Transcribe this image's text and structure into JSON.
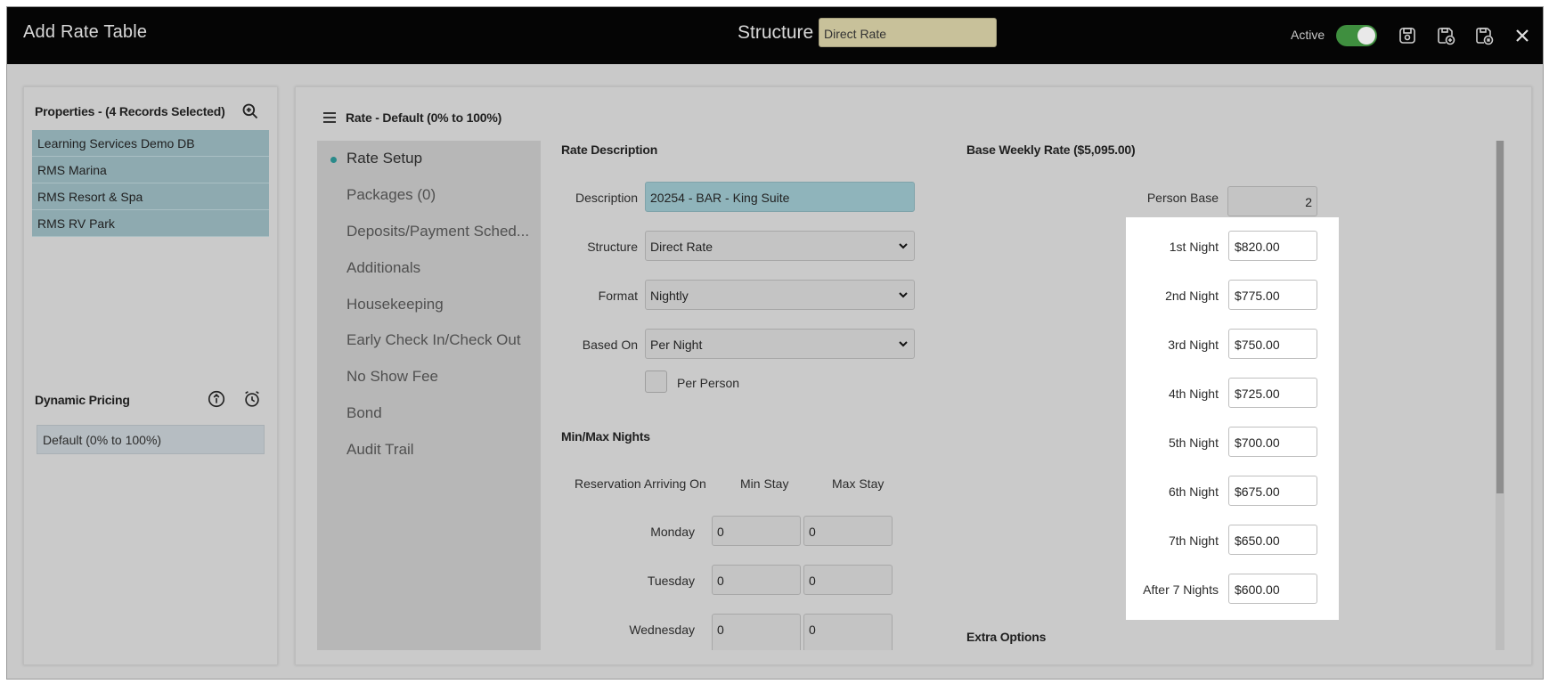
{
  "header": {
    "title": "Add Rate Table",
    "structure_label": "Structure",
    "structure_value": "Direct Rate",
    "active_label": "Active",
    "active": true,
    "icons": [
      "save-icon",
      "save-add-icon",
      "save-copy-icon",
      "close-icon"
    ]
  },
  "properties": {
    "heading": "Properties - (4 Records Selected)",
    "items": [
      "Learning Services Demo DB",
      "RMS Marina",
      "RMS Resort & Spa",
      "RMS RV Park"
    ]
  },
  "dynamic_pricing": {
    "heading": "Dynamic Pricing",
    "item": "Default (0% to 100%)"
  },
  "main": {
    "heading": "Rate - Default (0% to 100%)",
    "nav": [
      "Rate Setup",
      "Packages (0)",
      "Deposits/Payment Sched...",
      "Additionals",
      "Housekeeping",
      "Early Check In/Check Out",
      "No Show Fee",
      "Bond",
      "Audit Trail"
    ],
    "rate_description": {
      "heading": "Rate Description",
      "description_label": "Description",
      "description_value": "20254 - BAR - King Suite",
      "structure_label": "Structure",
      "structure_value": "Direct Rate",
      "format_label": "Format",
      "format_value": "Nightly",
      "based_on_label": "Based On",
      "based_on_value": "Per Night",
      "per_person_label": "Per Person"
    },
    "min_max": {
      "heading": "Min/Max Nights",
      "col_arriving": "Reservation Arriving On",
      "col_min": "Min Stay",
      "col_max": "Max Stay",
      "rows": [
        {
          "day": "Monday",
          "min": "0",
          "max": "0"
        },
        {
          "day": "Tuesday",
          "min": "0",
          "max": "0"
        },
        {
          "day": "Wednesday",
          "min": "0",
          "max": "0"
        }
      ]
    },
    "base_weekly": {
      "heading": "Base Weekly Rate ($5,095.00)",
      "person_base_label": "Person Base",
      "person_base_value": "2",
      "nights": [
        {
          "label": "1st Night",
          "value": "$820.00"
        },
        {
          "label": "2nd Night",
          "value": "$775.00"
        },
        {
          "label": "3rd Night",
          "value": "$750.00"
        },
        {
          "label": "4th Night",
          "value": "$725.00"
        },
        {
          "label": "5th Night",
          "value": "$700.00"
        },
        {
          "label": "6th Night",
          "value": "$675.00"
        },
        {
          "label": "7th Night",
          "value": "$650.00"
        },
        {
          "label": "After 7 Nights",
          "value": "$600.00"
        }
      ],
      "extra_options_heading": "Extra Options"
    }
  },
  "colors": {
    "header_bg": "#050505",
    "structure_field": "#c8c19a",
    "toggle_on": "#3f8f3f",
    "property_selected": "#8eaab0",
    "description_field": "#8fb4bb",
    "active_dot": "#2a8a8a"
  }
}
